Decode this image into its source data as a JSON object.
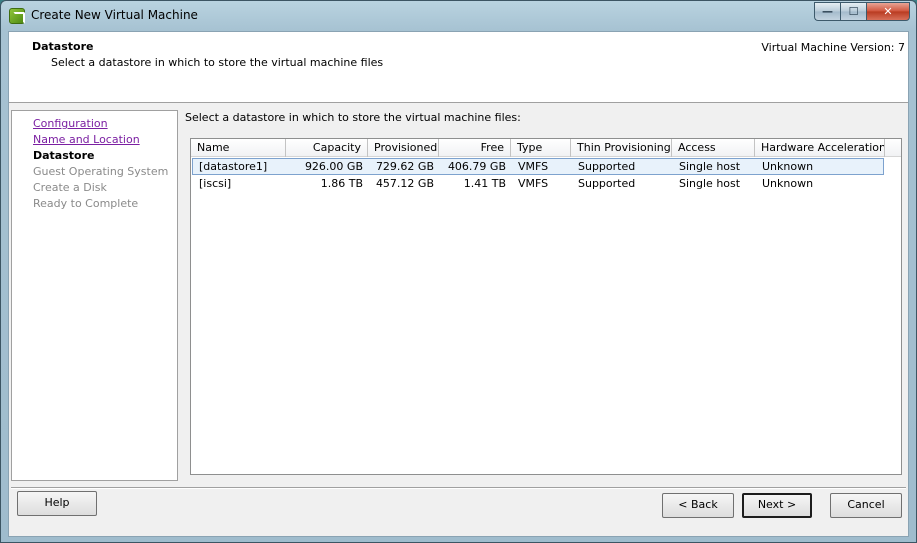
{
  "window": {
    "title": "Create New Virtual Machine",
    "controls": {
      "minimize": "—",
      "maximize": "☐",
      "close": "✕"
    }
  },
  "header": {
    "title": "Datastore",
    "subtitle": "Select a datastore in which to store the virtual machine files",
    "version": "Virtual Machine Version: 7"
  },
  "nav": {
    "items": [
      {
        "label": "Configuration",
        "state": "visited"
      },
      {
        "label": "Name and Location",
        "state": "visited"
      },
      {
        "label": "Datastore",
        "state": "current"
      },
      {
        "label": "Guest Operating System",
        "state": "disabled"
      },
      {
        "label": "Create a Disk",
        "state": "disabled"
      },
      {
        "label": "Ready to Complete",
        "state": "disabled"
      }
    ]
  },
  "content": {
    "label": "Select a datastore in which to store the virtual machine files:"
  },
  "table": {
    "columns": [
      "Name",
      "Capacity",
      "Provisioned",
      "Free",
      "Type",
      "Thin Provisioning",
      "Access",
      "Hardware Acceleration"
    ],
    "rows": [
      [
        "[datastore1]",
        "926.00 GB",
        "729.62 GB",
        "406.79 GB",
        "VMFS",
        "Supported",
        "Single host",
        "Unknown"
      ],
      [
        "[iscsi]",
        "1.86 TB",
        "457.12 GB",
        "1.41 TB",
        "VMFS",
        "Supported",
        "Single host",
        "Unknown"
      ]
    ],
    "selected_row": 0
  },
  "buttons": {
    "help": "Help",
    "back": "< Back",
    "next": "Next >",
    "cancel": "Cancel"
  },
  "colors": {
    "link_visited": "#7b1fa2",
    "disabled_text": "#8a8a8a",
    "selection_bg": "#e8f2fb",
    "selection_border": "#7da2ce"
  }
}
